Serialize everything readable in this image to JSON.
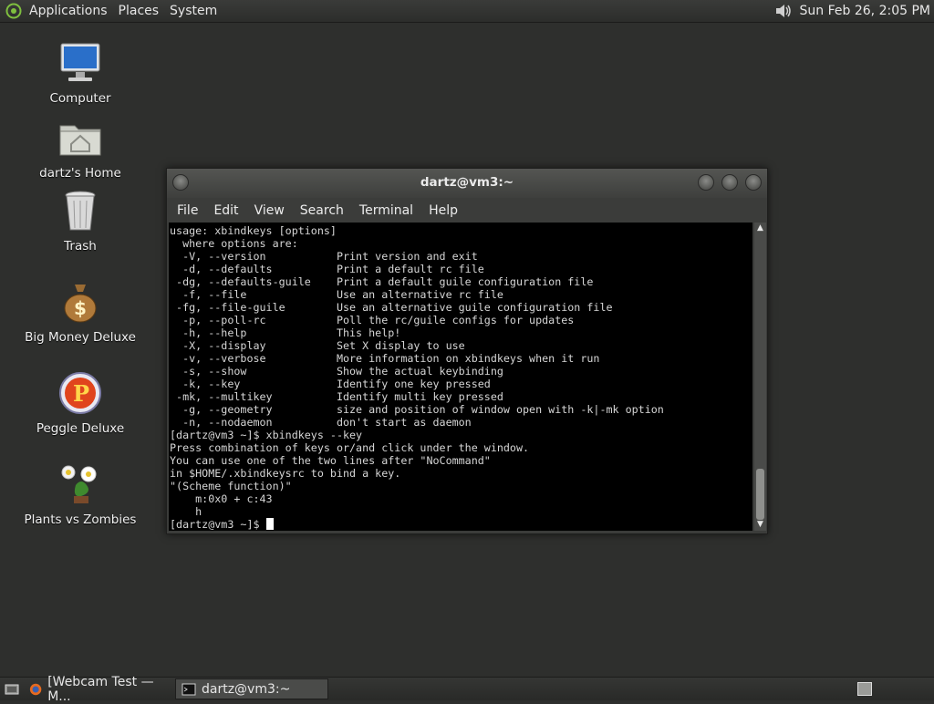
{
  "top_panel": {
    "menus": [
      "Applications",
      "Places",
      "System"
    ],
    "clock": "Sun Feb 26,  2:05 PM"
  },
  "desktop": {
    "icons": [
      {
        "label": "Computer",
        "icon": "computer-icon"
      },
      {
        "label": "dartz's Home",
        "icon": "home-folder-icon"
      },
      {
        "label": "Trash",
        "icon": "trash-icon"
      },
      {
        "label": "Big Money Deluxe",
        "icon": "money-bag-icon"
      },
      {
        "label": "Peggle Deluxe",
        "icon": "peggle-icon"
      },
      {
        "label": "Plants vs Zombies",
        "icon": "plants-icon"
      }
    ]
  },
  "terminal": {
    "title": "dartz@vm3:~",
    "menu": [
      "File",
      "Edit",
      "View",
      "Search",
      "Terminal",
      "Help"
    ],
    "lines": [
      "usage: xbindkeys [options]",
      "  where options are:",
      "  -V, --version           Print version and exit",
      "  -d, --defaults          Print a default rc file",
      " -dg, --defaults-guile    Print a default guile configuration file",
      "  -f, --file              Use an alternative rc file",
      " -fg, --file-guile        Use an alternative guile configuration file",
      "  -p, --poll-rc           Poll the rc/guile configs for updates",
      "  -h, --help              This help!",
      "  -X, --display           Set X display to use",
      "  -v, --verbose           More information on xbindkeys when it run",
      "  -s, --show              Show the actual keybinding",
      "  -k, --key               Identify one key pressed",
      " -mk, --multikey          Identify multi key pressed",
      "  -g, --geometry          size and position of window open with -k|-mk option",
      "  -n, --nodaemon          don't start as daemon",
      "[dartz@vm3 ~]$ xbindkeys --key",
      "Press combination of keys or/and click under the window.",
      "You can use one of the two lines after \"NoCommand\"",
      "in $HOME/.xbindkeysrc to bind a key.",
      "\"(Scheme function)\"",
      "    m:0x0 + c:43",
      "    h"
    ],
    "prompt": "[dartz@vm3 ~]$ "
  },
  "taskbar": {
    "tasks": [
      {
        "label": "[Webcam Test — M...",
        "active": false
      },
      {
        "label": "dartz@vm3:~",
        "active": true
      }
    ]
  }
}
